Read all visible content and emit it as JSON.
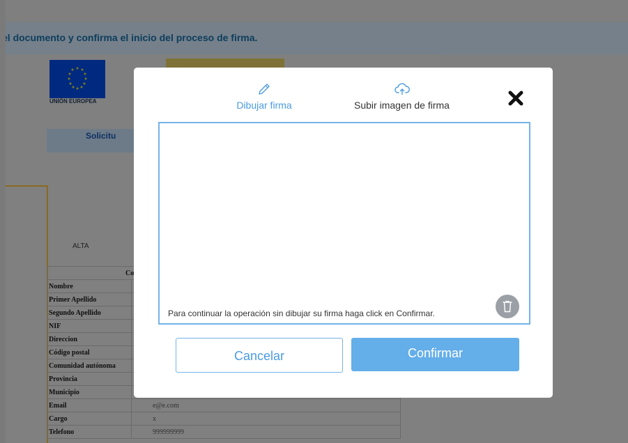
{
  "page": {
    "instruction": "el documento y confirma el inicio del proceso de firma."
  },
  "document": {
    "eu_label": "UNIÓN EUROPEA",
    "solicitud_partial": "Solicitu",
    "alta": "ALTA",
    "table_header_partial": "Con",
    "rows": [
      {
        "label": "Nombre",
        "value": ""
      },
      {
        "label": "Primer Apellido",
        "value": ""
      },
      {
        "label": "Segundo Apellido",
        "value": ""
      },
      {
        "label": "NIF",
        "value": ""
      },
      {
        "label": "Direccion",
        "value": ""
      },
      {
        "label": "Código postal",
        "value": ""
      },
      {
        "label": "Comunidad autónoma",
        "value": ""
      },
      {
        "label": "Provincia",
        "value": ""
      },
      {
        "label": "Municipio",
        "value": ""
      },
      {
        "label": "Email",
        "value": "e@e.com"
      },
      {
        "label": "Cargo",
        "value": "x"
      },
      {
        "label": "Telefono",
        "value": "999999999"
      }
    ]
  },
  "modal": {
    "tabs": [
      {
        "label": "Dibujar firma",
        "icon": "pencil-icon",
        "active": true
      },
      {
        "label": "Subir imagen de firma",
        "icon": "cloud-upload-icon",
        "active": false
      }
    ],
    "close_icon": "close-icon",
    "hint": "Para continuar la operación sin dibujar su firma haga click en Confirmar.",
    "trash_icon": "trash-icon",
    "cancel_label": "Cancelar",
    "confirm_label": "Confirmar"
  },
  "colors": {
    "accent": "#4a9be0",
    "confirm_bg": "#64aee9",
    "overlay": "#7f7f7f"
  }
}
